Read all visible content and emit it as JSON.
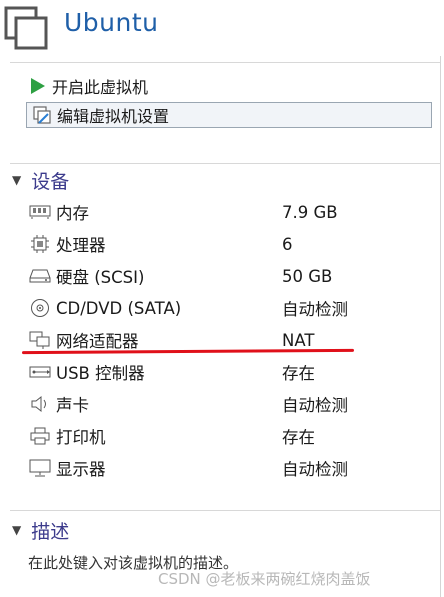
{
  "header": {
    "title": "Ubuntu",
    "icon": "vm-window-icon"
  },
  "actions": [
    {
      "label": "开启此虚拟机",
      "icon": "play-icon"
    },
    {
      "label": "编辑虚拟机设置",
      "icon": "edit-settings-icon"
    }
  ],
  "devices_section": {
    "title": "设备",
    "items": [
      {
        "name": "内存",
        "value": "7.9 GB",
        "icon": "memory-icon"
      },
      {
        "name": "处理器",
        "value": "6",
        "icon": "processor-icon"
      },
      {
        "name": "硬盘 (SCSI)",
        "value": "50 GB",
        "icon": "hard-disk-icon"
      },
      {
        "name": "CD/DVD (SATA)",
        "value": "自动检测",
        "icon": "cd-dvd-icon"
      },
      {
        "name": "网络适配器",
        "value": "NAT",
        "icon": "network-adapter-icon"
      },
      {
        "name": "USB 控制器",
        "value": "存在",
        "icon": "usb-icon"
      },
      {
        "name": "声卡",
        "value": "自动检测",
        "icon": "sound-card-icon"
      },
      {
        "name": "打印机",
        "value": "存在",
        "icon": "printer-icon"
      },
      {
        "name": "显示器",
        "value": "自动检测",
        "icon": "display-icon"
      }
    ]
  },
  "description_section": {
    "title": "描述",
    "placeholder": "在此处键入对该虚拟机的描述。"
  },
  "watermark": "CSDN @老板来两碗红烧肉盖饭",
  "colors": {
    "title": "#1f5fa8",
    "section": "#3c3b8c",
    "play": "#2ea043",
    "annotation": "#e0101a"
  }
}
